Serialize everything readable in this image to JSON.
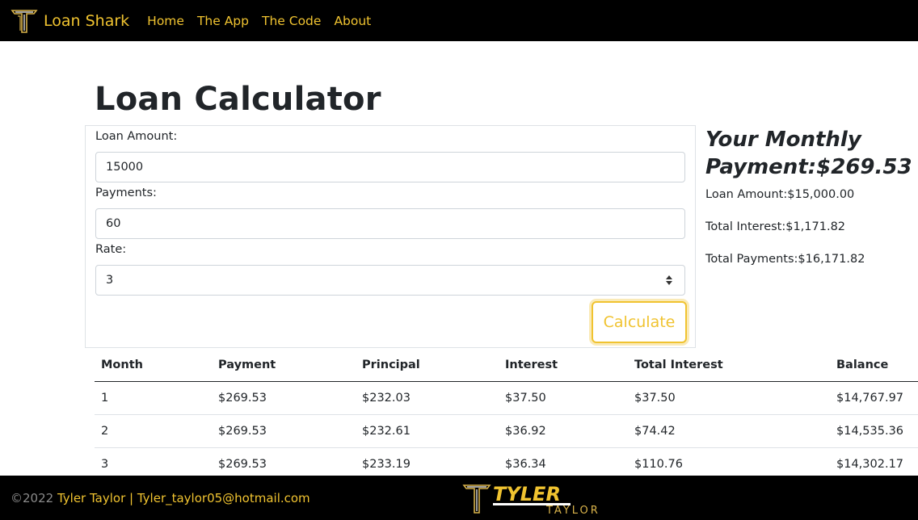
{
  "navbar": {
    "brand": "Loan Shark",
    "links": [
      "Home",
      "The App",
      "The Code",
      "About"
    ]
  },
  "page": {
    "title": "Loan Calculator"
  },
  "form": {
    "loan_amount_label": "Loan Amount:",
    "loan_amount_value": "15000",
    "payments_label": "Payments:",
    "payments_value": "60",
    "rate_label": "Rate:",
    "rate_value": "3",
    "calculate_label": "Calculate"
  },
  "results": {
    "monthly_payment_line1": "Your Monthly",
    "monthly_payment_line2": "Payment:$269.53",
    "loan_amount": "Loan Amount:$15,000.00",
    "total_interest": "Total Interest:$1,171.82",
    "total_payments": "Total Payments:$16,171.82"
  },
  "schedule": {
    "headers": [
      "Month",
      "Payment",
      "Principal",
      "Interest",
      "Total Interest",
      "Balance"
    ],
    "rows": [
      [
        "1",
        "$269.53",
        "$232.03",
        "$37.50",
        "$37.50",
        "$14,767.97"
      ],
      [
        "2",
        "$269.53",
        "$232.61",
        "$36.92",
        "$74.42",
        "$14,535.36"
      ],
      [
        "3",
        "$269.53",
        "$233.19",
        "$36.34",
        "$110.76",
        "$14,302.17"
      ]
    ]
  },
  "footer": {
    "copyright": "©2022",
    "author": " Tyler Taylor | Tyler_taylor05@hotmail.com",
    "logo_text_top": "TYLER",
    "logo_text_bottom": "TAYLOR"
  },
  "colors": {
    "accent": "#f0c330",
    "nav_bg": "#000000"
  },
  "icons": {
    "brand_logo": "t-monogram-icon",
    "footer_logo": "tyler-taylor-logo",
    "spinner": "number-spinner-icon"
  }
}
